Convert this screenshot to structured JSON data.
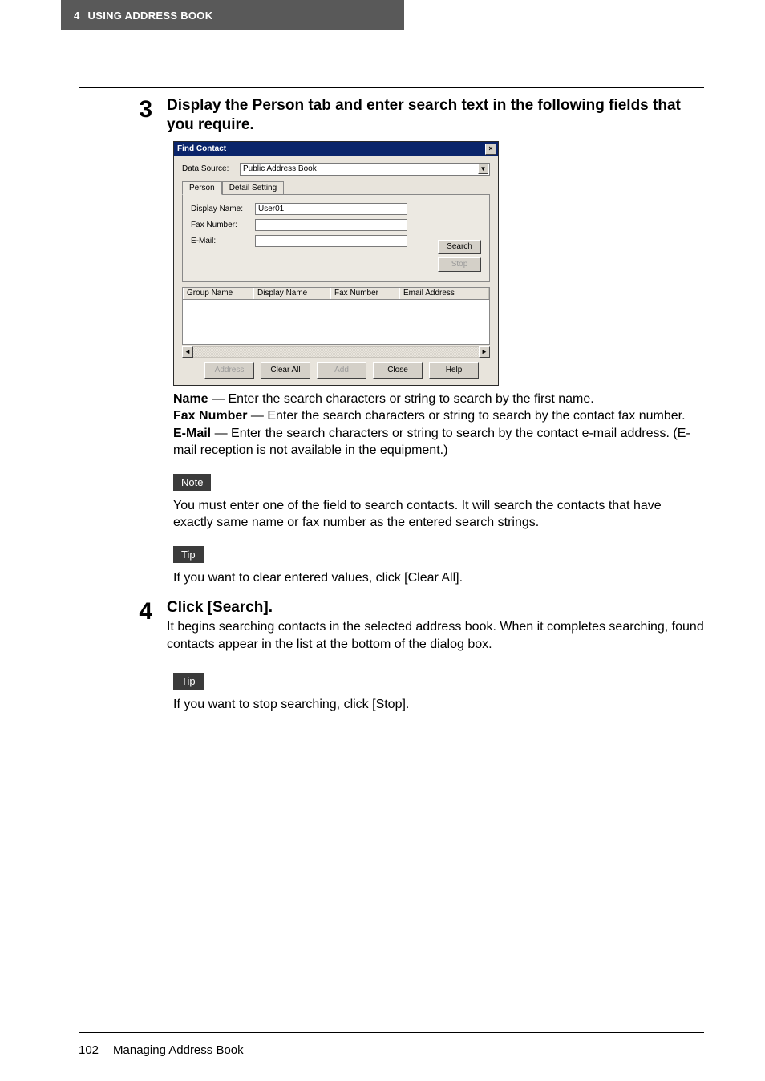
{
  "header": {
    "chapter_num": "4",
    "chapter_title": "USING ADDRESS BOOK"
  },
  "step3": {
    "num": "3",
    "title": "Display the Person tab and enter search text in the following fields that you require."
  },
  "dialog": {
    "title": "Find Contact",
    "data_source_label": "Data Source:",
    "data_source_value": "Public Address Book",
    "tabs": {
      "person": "Person",
      "detail": "Detail Setting"
    },
    "fields": {
      "display_name_label": "Display Name:",
      "display_name_value": "User01",
      "fax_label": "Fax Number:",
      "email_label": "E-Mail:"
    },
    "buttons": {
      "search": "Search",
      "stop": "Stop",
      "address": "Address",
      "clear_all": "Clear All",
      "add": "Add",
      "close": "Close",
      "help": "Help"
    },
    "columns": {
      "group_name": "Group Name",
      "display_name": "Display Name",
      "fax_number": "Fax Number",
      "email_address": "Email Address"
    }
  },
  "desc3": {
    "name_label": "Name",
    "name_text": " — Enter the search characters or string to search by the first name.",
    "fax_label": "Fax Number",
    "fax_text": " — Enter the search characters or string to search by the contact fax number.",
    "email_label": "E-Mail",
    "email_text": " — Enter the search characters or string to search by the contact e-mail address. (E-mail reception is not available in the equipment.)"
  },
  "note": {
    "label": "Note",
    "text": "You must enter one of the field to search contacts. It will search the contacts that have exactly same name or fax number as the entered search strings."
  },
  "tip1": {
    "label": "Tip",
    "text": "If you want to clear entered values, click [Clear All]."
  },
  "step4": {
    "num": "4",
    "title": "Click [Search].",
    "body": "It begins searching contacts in the selected address book. When it completes searching, found contacts appear in the list at the bottom of the dialog box."
  },
  "tip2": {
    "label": "Tip",
    "text": "If you want to stop searching, click [Stop]."
  },
  "footer": {
    "page": "102",
    "section": "Managing Address Book"
  }
}
